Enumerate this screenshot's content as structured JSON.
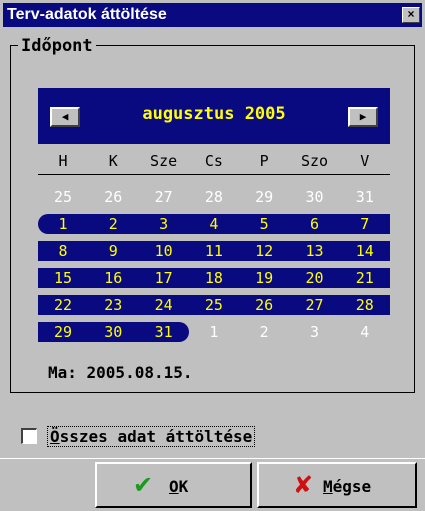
{
  "window": {
    "title": "Terv-adatok áttöltése",
    "close_glyph": "×"
  },
  "group": {
    "label": "Időpont"
  },
  "calendar": {
    "month_year": "augusztus 2005",
    "prev_glyph": "◀",
    "next_glyph": "▶",
    "weekdays": [
      "H",
      "K",
      "Sze",
      "Cs",
      "P",
      "Szo",
      "V"
    ],
    "weeks": [
      [
        "25",
        "26",
        "27",
        "28",
        "29",
        "30",
        "31"
      ],
      [
        "1",
        "2",
        "3",
        "4",
        "5",
        "6",
        "7"
      ],
      [
        "8",
        "9",
        "10",
        "11",
        "12",
        "13",
        "14"
      ],
      [
        "15",
        "16",
        "17",
        "18",
        "19",
        "20",
        "21"
      ],
      [
        "22",
        "23",
        "24",
        "25",
        "26",
        "27",
        "28"
      ],
      [
        "29",
        "30",
        "31",
        "1",
        "2",
        "3",
        "4"
      ]
    ],
    "colors": {
      "header_bg": "#0a0a80",
      "current_month_text": "#ffff00",
      "other_month_text": "#ffffff"
    }
  },
  "today": {
    "text": "Ma: 2005.08.15."
  },
  "checkbox": {
    "label": "Összes adat áttöltése",
    "checked": false
  },
  "buttons": {
    "ok_label": "OK",
    "cancel_label": "Mégse"
  },
  "icons": {
    "ok": "check-icon",
    "cancel": "x-icon"
  }
}
